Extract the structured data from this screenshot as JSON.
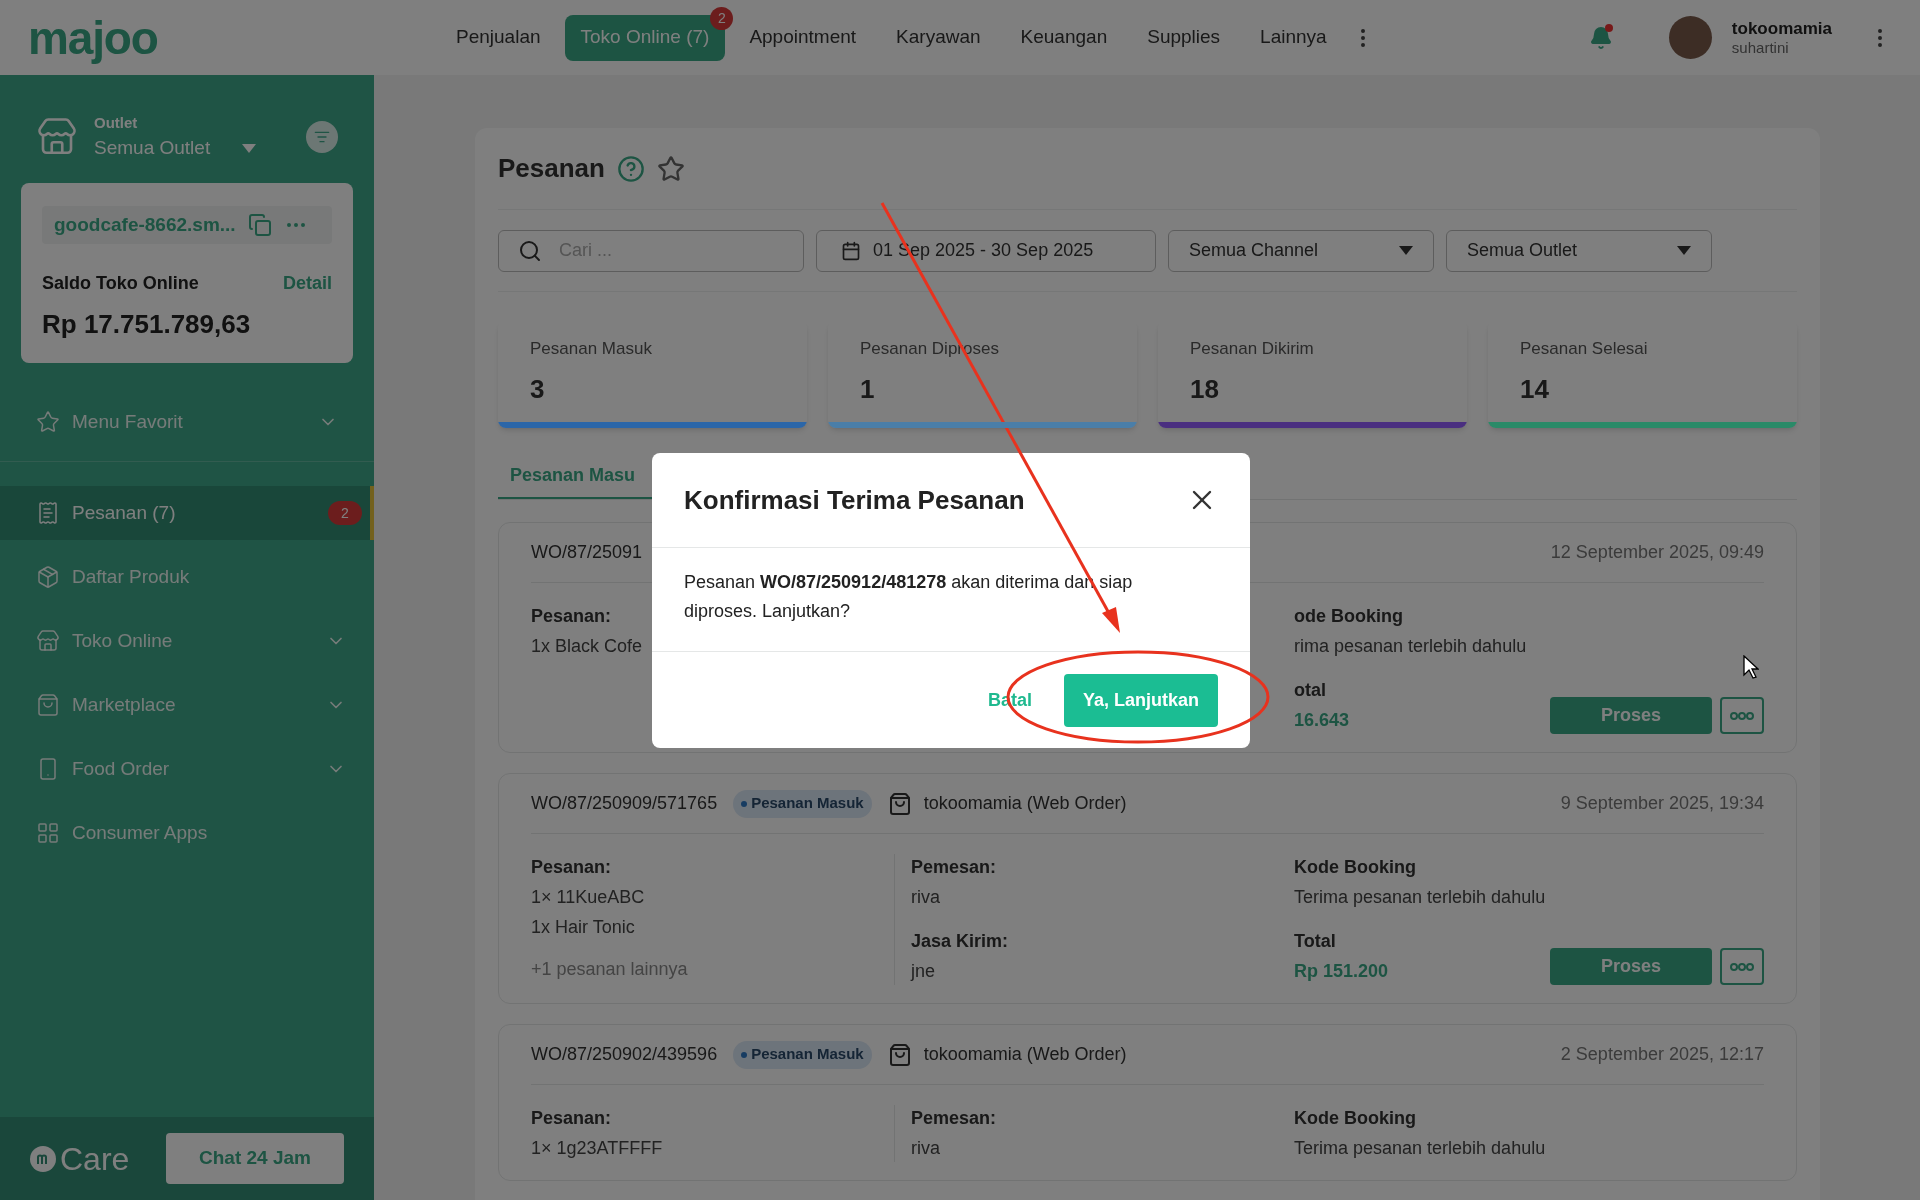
{
  "top_bar": {
    "logo": "majoo",
    "nav": [
      {
        "label": "Penjualan",
        "selected": false
      },
      {
        "label": "Toko Online (7)",
        "selected": true,
        "badge": "2"
      },
      {
        "label": "Appointment",
        "selected": false
      },
      {
        "label": "Karyawan",
        "selected": false
      },
      {
        "label": "Keuangan",
        "selected": false
      },
      {
        "label": "Supplies",
        "selected": false
      },
      {
        "label": "Lainnya",
        "selected": false
      }
    ],
    "user": {
      "name": "tokoomamia",
      "subtitle": "suhartini"
    }
  },
  "sidebar": {
    "outlet_label": "Outlet",
    "outlet_value": "Semua Outlet",
    "store": {
      "domain": "goodcafe-8662.sm...",
      "balance_label": "Saldo Toko Online",
      "detail_link": "Detail",
      "balance": "Rp 17.751.789,63"
    },
    "favorites": {
      "label": "Menu Favorit",
      "expanded": false
    },
    "items": [
      {
        "label": "Pesanan (7)",
        "selected": true,
        "badge": "2",
        "has_submenu": false
      },
      {
        "label": "Daftar Produk",
        "selected": false,
        "has_submenu": false
      },
      {
        "label": "Toko Online",
        "selected": false,
        "has_submenu": true
      },
      {
        "label": "Marketplace",
        "selected": false,
        "has_submenu": true
      },
      {
        "label": "Food Order",
        "selected": false,
        "has_submenu": true
      },
      {
        "label": "Consumer Apps",
        "selected": false,
        "has_submenu": false
      }
    ],
    "care": {
      "logo": "Care",
      "chat_button": "Chat 24 Jam"
    }
  },
  "page": {
    "title": "Pesanan",
    "search": {
      "placeholder": "Cari ..."
    },
    "date_range": "01 Sep 2025 - 30 Sep 2025",
    "filters": [
      "Semua Channel",
      "Semua Outlet"
    ],
    "stats": [
      {
        "label": "Pesanan Masuk",
        "value": "3",
        "color": "#2b66a8"
      },
      {
        "label": "Pesanan Diproses",
        "value": "1",
        "color": "#4a7ea8"
      },
      {
        "label": "Pesanan Dikirim",
        "value": "18",
        "color": "#4a2f80"
      },
      {
        "label": "Pesanan Selesai",
        "value": "14",
        "color": "#2a8a68"
      }
    ],
    "tab": "Pesanan Masu",
    "orders": [
      {
        "id": "WO/87/25091",
        "date": "12 September 2025, 09:49",
        "items_label": "Pesanan:",
        "items": [
          "1x Black Cofe"
        ],
        "booking_label": "ode Booking",
        "booking": "rima pesanan terlebih dahulu",
        "total_label": "otal",
        "total": "16.643",
        "action": "Proses"
      },
      {
        "id": "WO/87/250909/571765",
        "status": "Pesanan Masuk",
        "channel": "tokoomamia (Web Order)",
        "date": "9 September 2025, 19:34",
        "items_label": "Pesanan:",
        "items": [
          "1× 11KueABC",
          "1x Hair Tonic"
        ],
        "more_items": "+1 pesanan lainnya",
        "customer_label": "Pemesan:",
        "customer": "riva",
        "courier_label": "Jasa Kirim:",
        "courier": "jne",
        "booking_label": "Kode Booking",
        "booking": "Terima pesanan terlebih dahulu",
        "total_label": "Total",
        "total": "Rp 151.200",
        "action": "Proses"
      },
      {
        "id": "WO/87/250902/439596",
        "status": "Pesanan Masuk",
        "channel": "tokoomamia (Web Order)",
        "date": "2 September 2025, 12:17",
        "items_label": "Pesanan:",
        "items": [
          "1× 1g23ATFFFF"
        ],
        "customer_label": "Pemesan:",
        "customer": "riva",
        "booking_label": "Kode Booking",
        "booking": "Terima pesanan terlebih dahulu"
      }
    ]
  },
  "dialog": {
    "title": "Konfirmasi Terima Pesanan",
    "message": "Pesanan **WO/87/250912/481278** akan diterima dan siap diproses. Lanjutkan?",
    "cancel": "Batal",
    "confirm": "Ya, Lanjutkan"
  }
}
